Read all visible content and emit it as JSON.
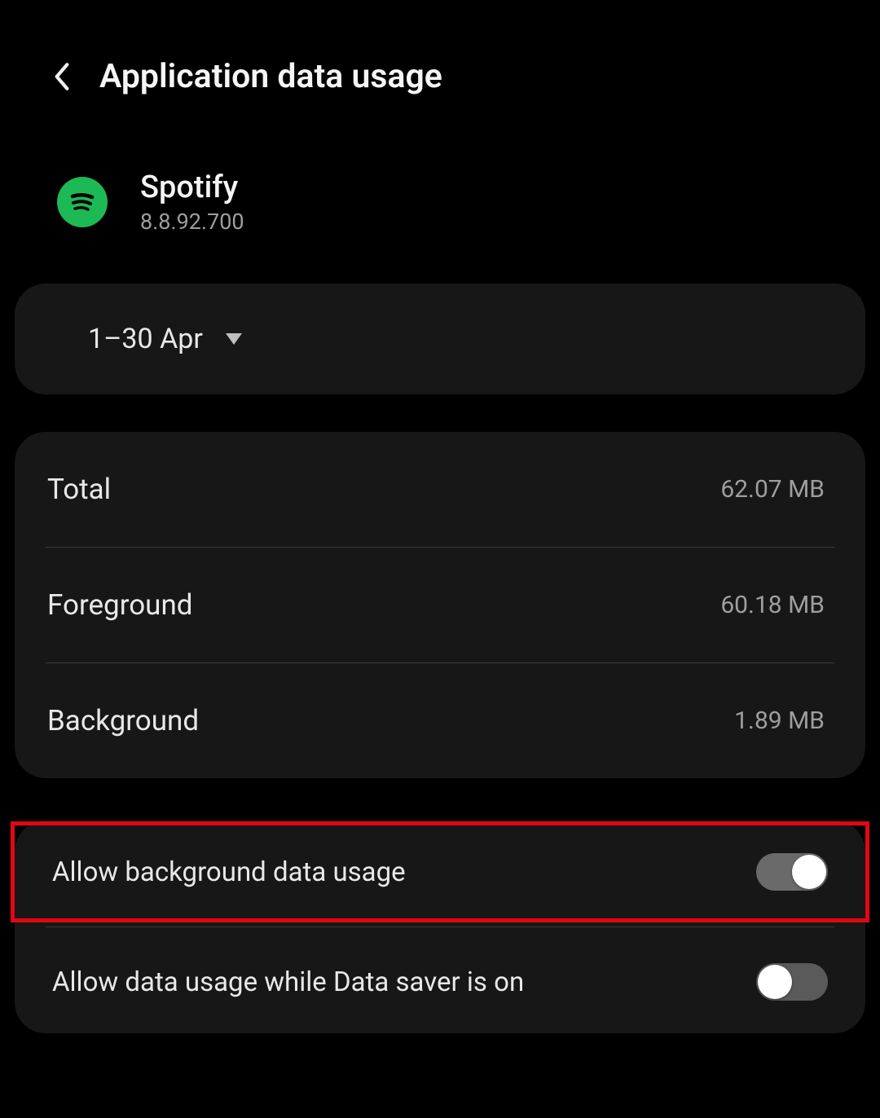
{
  "header": {
    "title": "Application data usage"
  },
  "app": {
    "name": "Spotify",
    "version": "8.8.92.700",
    "icon_semantic": "spotify-icon"
  },
  "date_range": {
    "label": "1–30 Apr"
  },
  "stats": {
    "total": {
      "label": "Total",
      "value": "62.07 MB"
    },
    "foreground": {
      "label": "Foreground",
      "value": "60.18 MB"
    },
    "background": {
      "label": "Background",
      "value": "1.89 MB"
    }
  },
  "settings": {
    "allow_background": {
      "label": "Allow background data usage",
      "enabled": true
    },
    "allow_data_saver": {
      "label": "Allow data usage while Data saver is on",
      "enabled": false
    }
  }
}
